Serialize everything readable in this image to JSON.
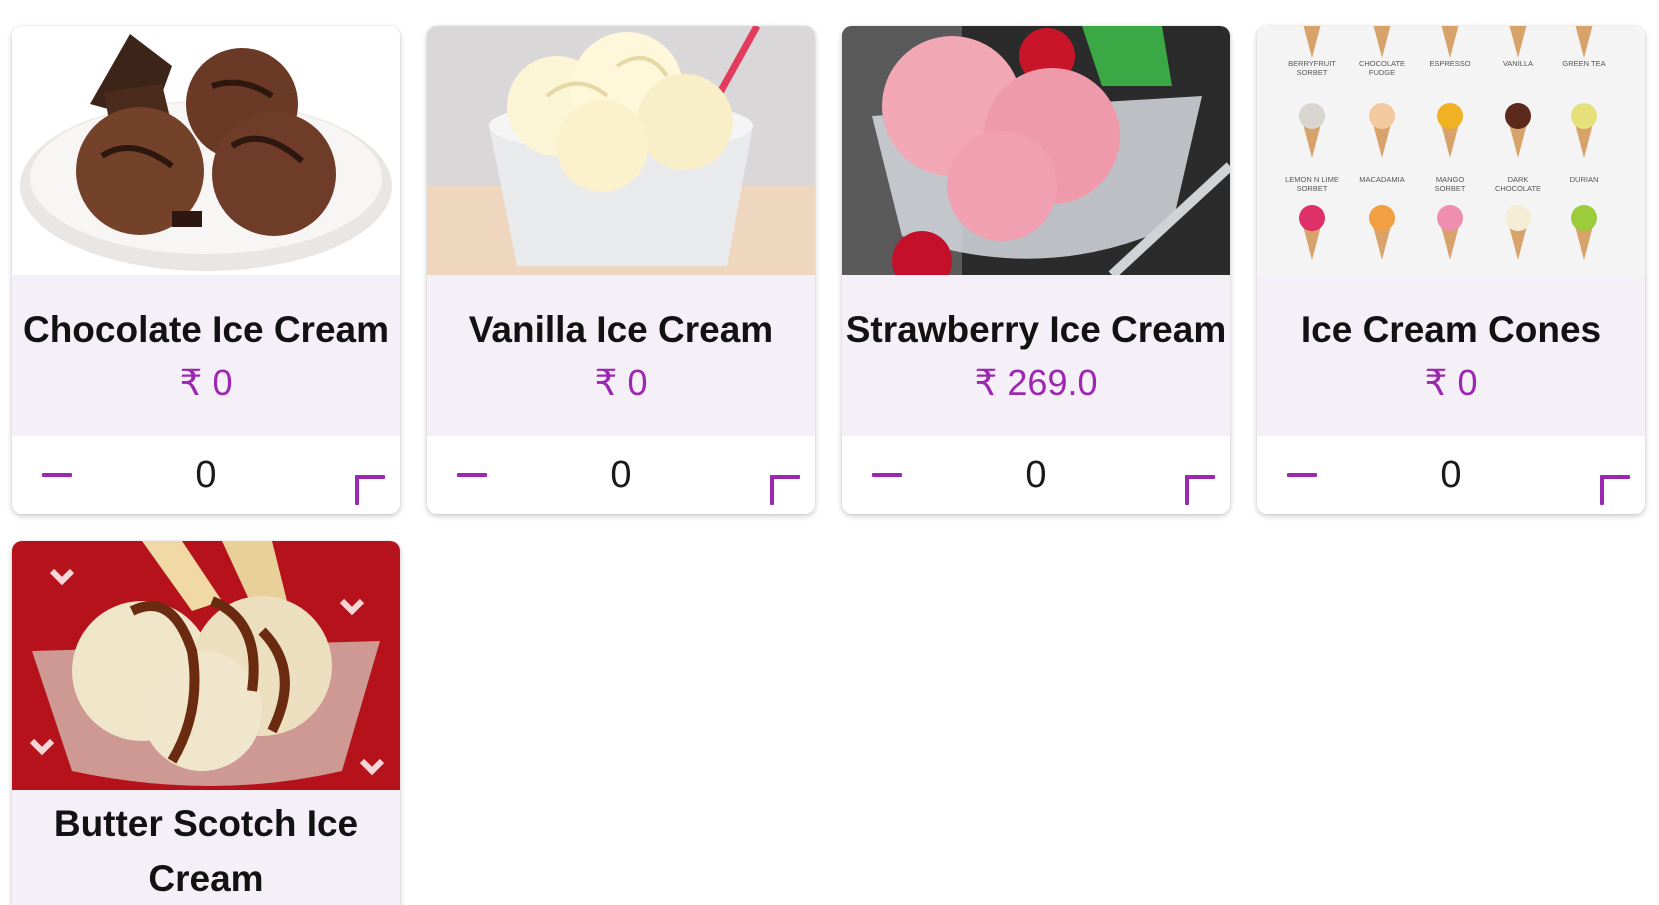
{
  "products": [
    {
      "name": "Chocolate Ice Cream",
      "price": "₹ 0",
      "quantity": "0",
      "image": "chocolate-ice-cream-photo"
    },
    {
      "name": "Vanilla Ice Cream",
      "price": "₹ 0",
      "quantity": "0",
      "image": "vanilla-ice-cream-photo"
    },
    {
      "name": "Strawberry Ice Cream",
      "price": "₹ 269.0",
      "quantity": "0",
      "image": "strawberry-ice-cream-photo"
    },
    {
      "name": "Ice Cream Cones",
      "price": "₹ 0",
      "quantity": "0",
      "image": "ice-cream-cones-photo",
      "cone_labels": [
        "BERRYFRUIT SORBET",
        "CHOCOLATE FUDGE",
        "ESPRESSO",
        "VANILLA",
        "GREEN TEA",
        "LEMON N LIME SORBET",
        "MACADAMIA",
        "MANGO SORBET",
        "DARK CHOCOLATE",
        "DURIAN"
      ]
    },
    {
      "name": "Butter Scotch Ice Cream",
      "image": "butter-scotch-ice-cream-photo"
    }
  ],
  "colors": {
    "accent": "#9c27b0",
    "info_bg": "#f5eff8"
  },
  "icons": {
    "decrement": "minus-icon",
    "increment": "plus-icon"
  }
}
